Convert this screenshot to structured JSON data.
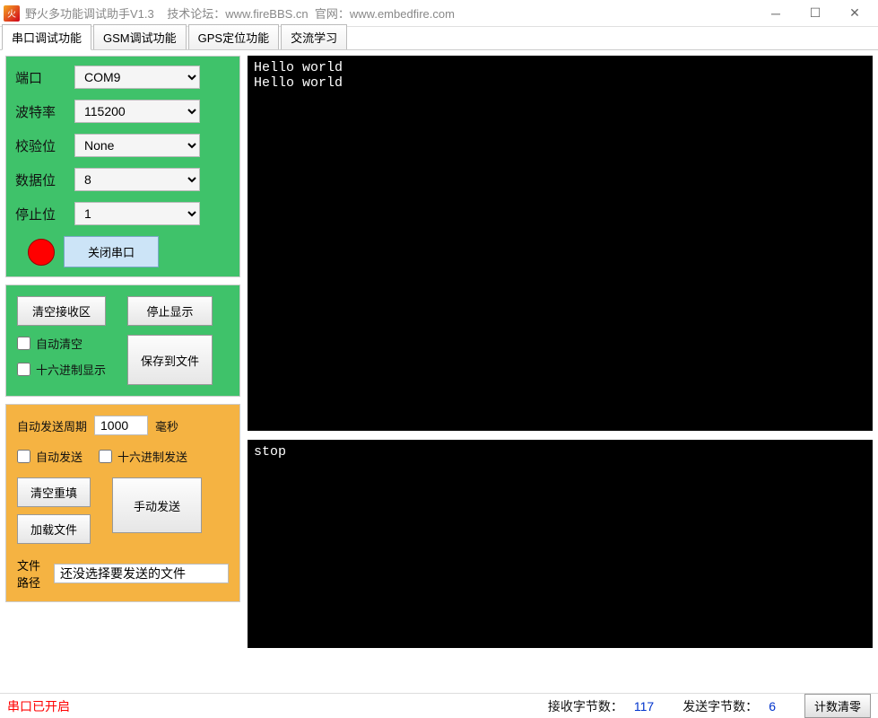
{
  "window": {
    "title": "野火多功能调试助手V1.3    技术论坛：www.fireBBS.cn  官网：www.embedfire.com"
  },
  "tabs": [
    {
      "label": "串口调试功能",
      "active": true
    },
    {
      "label": "GSM调试功能",
      "active": false
    },
    {
      "label": "GPS定位功能",
      "active": false
    },
    {
      "label": "交流学习",
      "active": false
    }
  ],
  "serial": {
    "labels": {
      "port": "端口",
      "baud": "波特率",
      "parity": "校验位",
      "data": "数据位",
      "stop": "停止位"
    },
    "port": "COM9",
    "baud": "115200",
    "parity": "None",
    "data": "8",
    "stop": "1",
    "close_btn": "关闭串口"
  },
  "recv_ctrl": {
    "clear_btn": "清空接收区",
    "stop_btn": "停止显示",
    "auto_clear": "自动清空",
    "hex_disp": "十六进制显示",
    "save_btn": "保存到文件"
  },
  "send_ctrl": {
    "period_lbl": "自动发送周期",
    "period_val": "1000",
    "period_unit": "毫秒",
    "auto_send": "自动发送",
    "hex_send": "十六进制发送",
    "clear_refill": "清空重填",
    "load_file": "加载文件",
    "manual_send": "手动发送",
    "filepath_lbl": "文件路径",
    "filepath_val": "还没选择要发送的文件"
  },
  "terminal": {
    "recv": "Hello world\nHello world",
    "send": "stop"
  },
  "status": {
    "open_text": "串口已开启",
    "recv_lbl": "接收字节数：",
    "recv_val": "117",
    "send_lbl": "发送字节数：",
    "send_val": "6",
    "clear_btn": "计数清零"
  }
}
